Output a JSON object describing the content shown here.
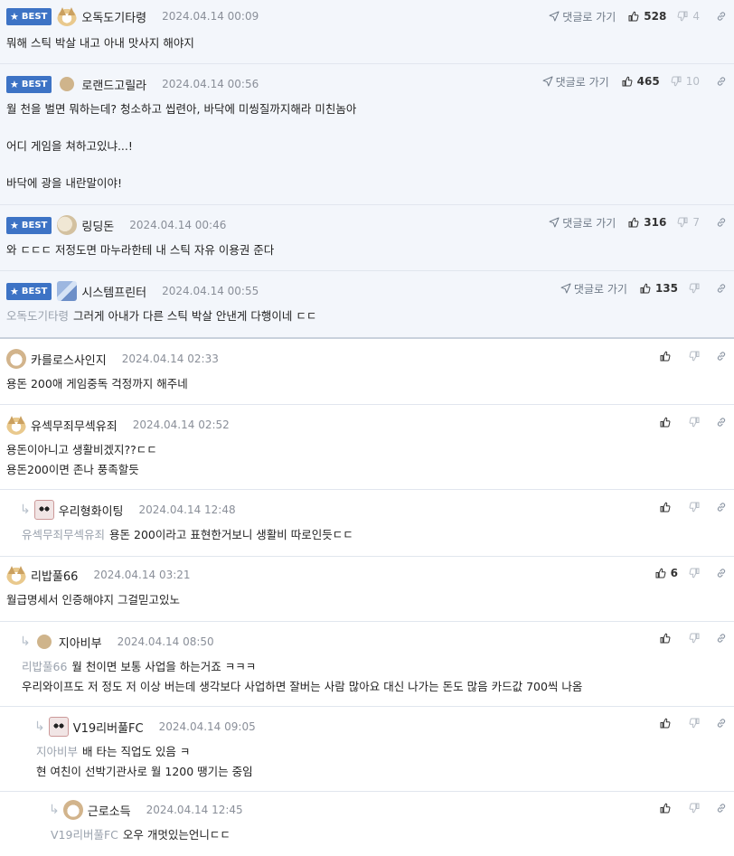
{
  "labels": {
    "best": "BEST",
    "goto": "댓글로 가기"
  },
  "best": [
    {
      "nick": "오독도기타령",
      "date": "2024.04.14 00:09",
      "likes": "528",
      "dislikes": "4",
      "lines": [
        "뭐해 스틱 박살 내고 아내 맛사지 해야지"
      ]
    },
    {
      "nick": "로랜드고릴라",
      "date": "2024.04.14 00:56",
      "likes": "465",
      "dislikes": "10",
      "lines": [
        "월 천을 벌면 뭐하는데? 청소하고 씹련아, 바닥에 미씽질까지해라 미친놈아",
        "",
        "어디 게임을 쳐하고있냐...!",
        "",
        "바닥에 광을 내란말이야!"
      ]
    },
    {
      "nick": "링딩돈",
      "date": "2024.04.14 00:46",
      "likes": "316",
      "dislikes": "7",
      "lines": [
        "와 ㄷㄷㄷ 저정도면 마누라한테 내 스틱 자유 이용권 준다"
      ]
    },
    {
      "nick": "시스템프린터",
      "date": "2024.04.14 00:55",
      "likes": "135",
      "dislikes": "",
      "mention": "오독도기타령",
      "lines": [
        "그러게 아내가 다른 스틱 박살 안낸게 다행이네 ㄷㄷ"
      ]
    }
  ],
  "comments": [
    {
      "nick": "카를로스사인지",
      "date": "2024.04.14 02:33",
      "likes": "",
      "lines": [
        "용돈 200애 게임중독 걱정까지 해주네"
      ]
    },
    {
      "nick": "유섹무죄무섹유죄",
      "date": "2024.04.14 02:52",
      "likes": "",
      "lines": [
        "용돈이아니고 생활비겠지??ㄷㄷ",
        "용돈200이면 존나 풍족할듯"
      ]
    },
    {
      "nick": "우리형화이팅",
      "date": "2024.04.14 12:48",
      "likes": "",
      "mention": "유섹무죄무섹유죄",
      "lines": [
        "용돈 200이라고 표현한거보니 생활비 따로인듯ㄷㄷ"
      ]
    },
    {
      "nick": "리밥풀66",
      "date": "2024.04.14 03:21",
      "likes": "6",
      "lines": [
        "월급명세서 인증해야지 그걸믿고있노"
      ]
    },
    {
      "nick": "지아비부",
      "date": "2024.04.14 08:50",
      "likes": "",
      "mention": "리밥풀66",
      "lines": [
        "월 천이면 보통 사업을 하는거죠 ㅋㅋㅋ",
        "우리와이프도 저 정도 저 이상 버는데 생각보다 사업하면 잘버는 사람 많아요 대신 나가는 돈도 많음 카드값 700씩 나옴"
      ]
    },
    {
      "nick": "V19리버풀FC",
      "date": "2024.04.14 09:05",
      "likes": "",
      "mention": "지아비부",
      "lines": [
        "배 타는 직업도 있음 ㅋ",
        "현 여친이 선박기관사로 월 1200 땡기는 중임"
      ]
    },
    {
      "nick": "근로소득",
      "date": "2024.04.14 12:45",
      "likes": "",
      "mention": "V19리버풀FC",
      "lines": [
        "오우 개멋있는언니ㄷㄷ"
      ]
    }
  ]
}
